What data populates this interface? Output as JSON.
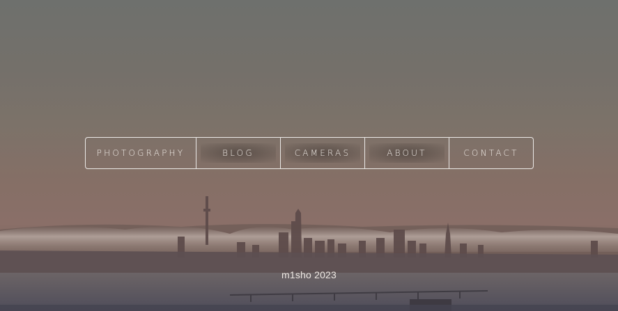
{
  "nav": {
    "items": [
      {
        "label": "PHOTOGRAPHY"
      },
      {
        "label": "BLOG"
      },
      {
        "label": "CAMERAS"
      },
      {
        "label": "ABOUT"
      },
      {
        "label": "CONTACT"
      }
    ]
  },
  "footer": {
    "text": "m1sho 2023"
  },
  "background": {
    "description_icon": "city-skyline-sunset-photo",
    "colors": {
      "sky_top": "#6e706d",
      "sky_mid": "#856f66",
      "water": "#54505a",
      "text": "#efe9e4"
    }
  }
}
